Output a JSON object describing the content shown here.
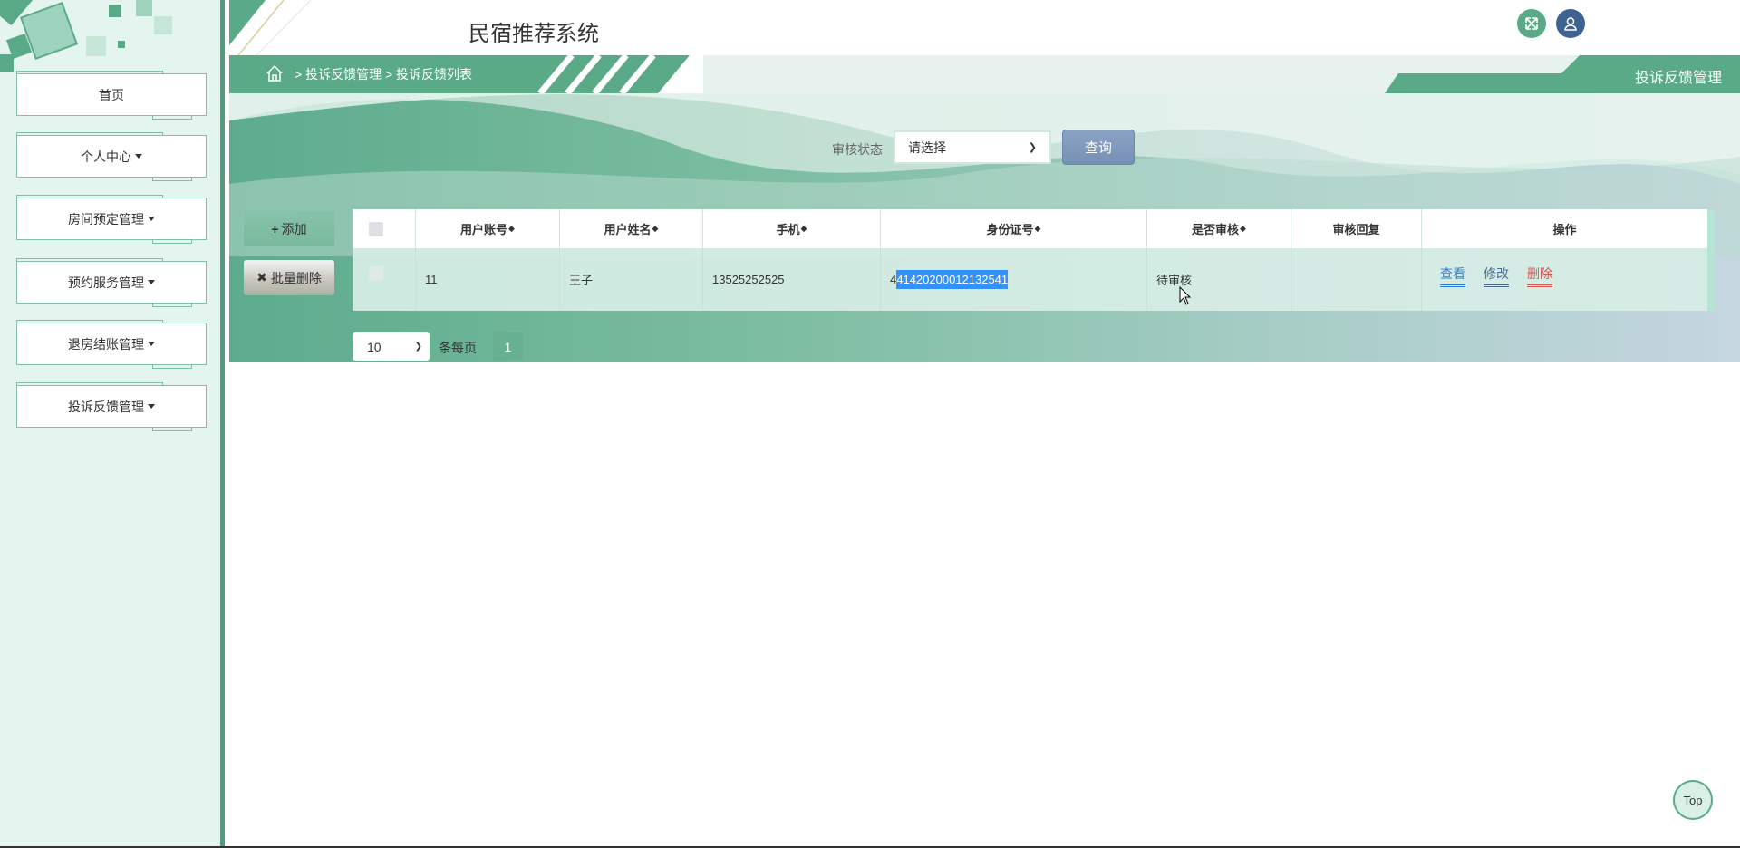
{
  "header": {
    "title": "民宿推荐系统",
    "icons": [
      "fullscreen-icon",
      "user-icon"
    ]
  },
  "sidebar": {
    "items": [
      {
        "label": "首页",
        "dropdown": false
      },
      {
        "label": "个人中心",
        "dropdown": true
      },
      {
        "label": "房间预定管理",
        "dropdown": true
      },
      {
        "label": "预约服务管理",
        "dropdown": true
      },
      {
        "label": "退房结账管理",
        "dropdown": true
      },
      {
        "label": "投诉反馈管理",
        "dropdown": true
      }
    ]
  },
  "breadcrumb": {
    "sep": ">",
    "items": [
      "投诉反馈管理",
      "投诉反馈列表"
    ]
  },
  "page_title": "投诉反馈管理",
  "search": {
    "label": "审核状态",
    "select_value": "请选择",
    "button": "查询"
  },
  "actions": {
    "add": "添加",
    "batch_delete": "批量删除"
  },
  "table": {
    "columns": [
      "用户账号",
      "用户姓名",
      "手机",
      "身份证号",
      "是否审核",
      "审核回复",
      "操作"
    ],
    "sortable": [
      true,
      true,
      true,
      true,
      true,
      false,
      false
    ],
    "rows": [
      {
        "account": "11",
        "name": "王子",
        "phone": "13525252525",
        "id_prefix": "4",
        "id_selected": "41420200012132541",
        "reviewed": "待审核",
        "reply": "",
        "ops": [
          "查看",
          "修改",
          "删除"
        ]
      }
    ]
  },
  "pagination": {
    "page_size": "10",
    "label": "条每页",
    "current": "1"
  },
  "top_button": "Top",
  "colors": {
    "primary": "#5aaa88",
    "view": "#2b7fd0",
    "edit": "#4a6a8f",
    "delete": "#d9534f",
    "selection": "#3390ff"
  }
}
